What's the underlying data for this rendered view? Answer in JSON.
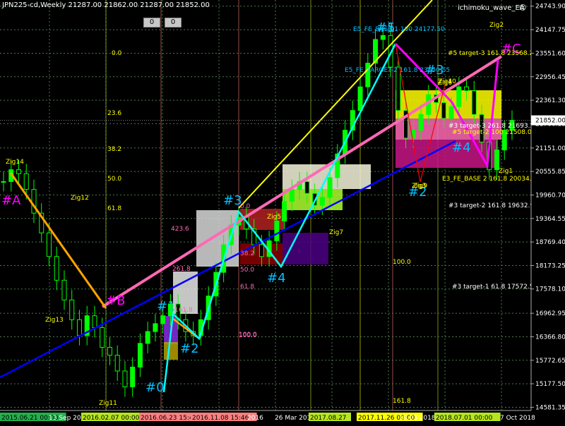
{
  "header": {
    "symbol_line": "JPN225-cd,Weekly  21287.00 21862.00 21287.00 21852.00",
    "indicator_name": "ichimoku_wave_EA",
    "button_left": "0",
    "button_right": "0"
  },
  "chart_data": {
    "type": "candlestick",
    "symbol": "JPN225-cd",
    "timeframe": "Weekly",
    "ohlc_last": {
      "open": 21287.0,
      "high": 21862.0,
      "low": 21287.0,
      "close": 21852.0
    },
    "current_price": "21852.00",
    "ylim": [
      14500,
      24900
    ],
    "y_ticks": [
      "24743.90",
      "24147.75",
      "23551.60",
      "22956.45",
      "22361.30",
      "21766.15",
      "21151.00",
      "20555.85",
      "19960.70",
      "19364.55",
      "18769.40",
      "18173.25",
      "17578.10",
      "16962.95",
      "16366.80",
      "15772.65",
      "15177.50",
      "14581.35"
    ],
    "x_ticks": [
      {
        "label": "2015.06.21 00:00",
        "bg": "#22b14c"
      },
      {
        "label": "13 Sep 2015",
        "bg": ""
      },
      {
        "label": "2016.02.07 00:00",
        "bg": "#b5e61d"
      },
      {
        "label": "2016.06.23 15:46",
        "bg": "#ff7f7f"
      },
      {
        "label": "2016.11.08 15:46",
        "bg": "#ff7f7f"
      },
      {
        "label": "2016",
        "bg": ""
      },
      {
        "label": "26 Mar 2017",
        "bg": ""
      },
      {
        "label": "2017.08.27",
        "bg": "#b5e61d"
      },
      {
        "label": "2017.11.26 00:00",
        "bg": "#ffff00"
      },
      {
        "label": "18.03 2018",
        "bg": ""
      },
      {
        "label": "2018.07.01 00:00",
        "bg": "#b5e61d"
      },
      {
        "label": "7 Oct 2018",
        "bg": ""
      }
    ],
    "wave_labels": [
      "#0",
      "#1",
      "#2",
      "#3",
      "#4",
      "#5",
      "#A",
      "#B",
      "#C",
      "#1",
      "#2",
      "#3",
      "#4"
    ],
    "zigzag_labels": [
      "Zig14",
      "Zig13",
      "Zig12",
      "Zig11",
      "Zig10",
      "Zig7",
      "Zig9",
      "Zig6",
      "Zig2",
      "Zig4",
      "Zig3",
      "Zig1",
      "Zig5"
    ],
    "annotations": [
      "E5_FE_BASE-1 100 24177.50",
      "E5_FE_TARGET-2 161.8 23550.55",
      "#5 target-3 161.8 23568.24",
      "#3 target-3 261.8 21693.29",
      "#5 target-2 100 21508.04",
      "E3_FE_BASE 2 161.8 20034.58",
      "#3 target-2 161.8 19632.90",
      "#3 target-1 61.8 17572.51"
    ],
    "fib_levels_upper": [
      "0.0",
      "23.6",
      "38.2",
      "50.0",
      "61.8",
      "100.0",
      "161.8"
    ],
    "fib_levels_lower": [
      "423.6",
      "261.8",
      "161.8",
      "100.0",
      "0.0",
      "38.2",
      "50.0",
      "61.8",
      "100.0"
    ],
    "series": [
      {
        "name": "price",
        "values": [
          20300,
          20600,
          20500,
          20100,
          19500,
          19000,
          18400,
          17800,
          17300,
          16800,
          16400,
          16900,
          16600,
          16100,
          15900,
          15500,
          15100,
          15600,
          16200,
          16500,
          16700,
          16900,
          17200,
          16800,
          16500,
          16400,
          16800,
          17400,
          18000,
          18700,
          19200,
          19400,
          19100,
          18700,
          18400,
          18800,
          19300,
          19800,
          20100,
          20300,
          20000,
          19700,
          19900,
          20400,
          21000,
          21600,
          22100,
          22700,
          23300,
          23900,
          24000,
          23200,
          22100,
          21400,
          21600,
          22000,
          22500,
          22300,
          21900,
          22200,
          22700,
          22600,
          22000,
          21300,
          20600,
          21100,
          21600,
          21852
        ]
      }
    ]
  },
  "colors": {
    "background": "#000000",
    "grid": "#4a7a4a",
    "candle_up": "#00ff00",
    "wave_line_pink": "#ff69b4",
    "trend_blue": "#0000ff",
    "trend_yellow": "#ffff00",
    "wave_orange": "#ffa500",
    "wave_cyan": "#00ffff",
    "wave_magenta": "#ff00ff"
  }
}
